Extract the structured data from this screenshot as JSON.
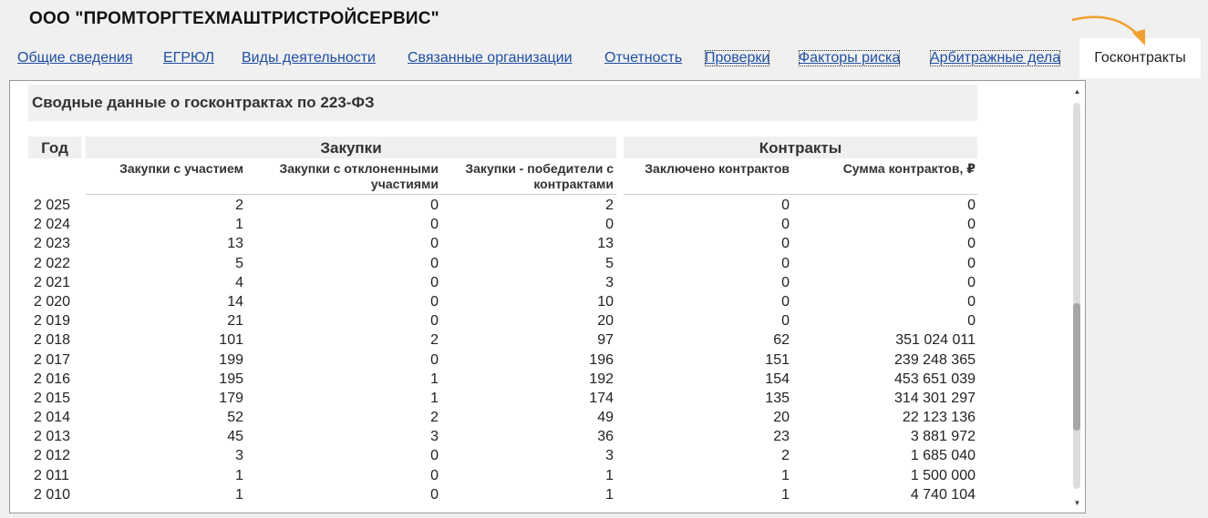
{
  "company": {
    "title": "ООО \"ПРОМТОРГТЕХМАШТРИСТРОЙСЕРВИС\""
  },
  "tabs": {
    "items": [
      {
        "label": "Общие сведения"
      },
      {
        "label": "ЕГРЮЛ"
      },
      {
        "label": "Виды деятельности"
      },
      {
        "label": "Связанные организации"
      },
      {
        "label": "Отчетность"
      },
      {
        "label": "Проверки"
      },
      {
        "label": "Факторы риска"
      },
      {
        "label": "Арбитражные дела"
      }
    ],
    "active_label": "Госконтракты"
  },
  "section": {
    "title": "Сводные данные о госконтрактах по 223-ФЗ"
  },
  "table": {
    "year_header": "Год",
    "groups": {
      "purchases": "Закупки",
      "contracts": "Контракты"
    },
    "columns": {
      "participated": "Закупки с участием",
      "rejected": "Закупки с отклоненными участиями",
      "winners": "Закупки - победители с контрактами",
      "concluded": "Заключено контрактов",
      "sum": "Сумма контрактов, ₽"
    },
    "rows": [
      {
        "year": "2 025",
        "participated": "2",
        "rejected": "0",
        "winners": "2",
        "concluded": "0",
        "sum": "0"
      },
      {
        "year": "2 024",
        "participated": "1",
        "rejected": "0",
        "winners": "0",
        "concluded": "0",
        "sum": "0"
      },
      {
        "year": "2 023",
        "participated": "13",
        "rejected": "0",
        "winners": "13",
        "concluded": "0",
        "sum": "0"
      },
      {
        "year": "2 022",
        "participated": "5",
        "rejected": "0",
        "winners": "5",
        "concluded": "0",
        "sum": "0"
      },
      {
        "year": "2 021",
        "participated": "4",
        "rejected": "0",
        "winners": "3",
        "concluded": "0",
        "sum": "0"
      },
      {
        "year": "2 020",
        "participated": "14",
        "rejected": "0",
        "winners": "10",
        "concluded": "0",
        "sum": "0"
      },
      {
        "year": "2 019",
        "participated": "21",
        "rejected": "0",
        "winners": "20",
        "concluded": "0",
        "sum": "0"
      },
      {
        "year": "2 018",
        "participated": "101",
        "rejected": "2",
        "winners": "97",
        "concluded": "62",
        "sum": "351 024 011"
      },
      {
        "year": "2 017",
        "participated": "199",
        "rejected": "0",
        "winners": "196",
        "concluded": "151",
        "sum": "239 248 365"
      },
      {
        "year": "2 016",
        "participated": "195",
        "rejected": "1",
        "winners": "192",
        "concluded": "154",
        "sum": "453 651 039"
      },
      {
        "year": "2 015",
        "participated": "179",
        "rejected": "1",
        "winners": "174",
        "concluded": "135",
        "sum": "314 301 297"
      },
      {
        "year": "2 014",
        "participated": "52",
        "rejected": "2",
        "winners": "49",
        "concluded": "20",
        "sum": "22 123 136"
      },
      {
        "year": "2 013",
        "participated": "45",
        "rejected": "3",
        "winners": "36",
        "concluded": "23",
        "sum": "3 881 972"
      },
      {
        "year": "2 012",
        "participated": "3",
        "rejected": "0",
        "winners": "3",
        "concluded": "2",
        "sum": "1 685 040"
      },
      {
        "year": "2 011",
        "participated": "1",
        "rejected": "0",
        "winners": "1",
        "concluded": "1",
        "sum": "1 500 000"
      },
      {
        "year": "2 010",
        "participated": "1",
        "rejected": "0",
        "winners": "1",
        "concluded": "1",
        "sum": "4 740 104"
      }
    ]
  },
  "scrollbar": {
    "up_icon": "scroll-up-arrow-icon",
    "down_icon": "scroll-down-arrow-icon",
    "position": 0.55
  },
  "colors": {
    "link": "#1f4fa0",
    "accent_arrow": "#f0a030",
    "header_bg": "#f0f0f0"
  }
}
